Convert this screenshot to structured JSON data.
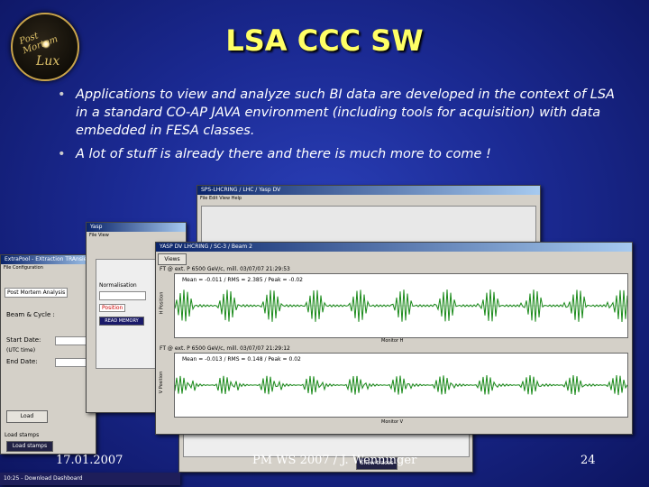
{
  "header": {
    "logo_text_top": "Post Mortem",
    "logo_text_bottom": "Lux",
    "title": "LSA CCC SW"
  },
  "bullets": [
    "Applications to view and analyze such BI data are developed in the context of LSA in a standard CO-AP JAVA environment (including tools for acquisition) with data embedded in FESA classes.",
    "A lot of stuff is already there and there is much more to come !"
  ],
  "screens": {
    "back_window_title": "SPS-LHCRING / LHC / Yasp DV",
    "left_window_title": "ExtraPool - EXtraction TRAnsient",
    "left_window": {
      "tab": "Post Mortem Analysis",
      "beam_cycle": "Beam & Cycle :",
      "start_date": "Start Date:",
      "utc_time": "(UTC time)",
      "end_date": "End Date:",
      "load_button": "Load",
      "tab2": "Load stamps",
      "status": "Load stamps"
    },
    "mid_window": {
      "label1": "Normalisation",
      "label2": "Position",
      "button": "READ MEMORY"
    },
    "front_window_title": "YASP DV LHCRING / SC-3 / Beam 2",
    "front_window": {
      "views_button": "Views",
      "plot1_header": "FT @ ext. P 6500 GeV/c, mill. 03/07/07 21:29:53",
      "plot1_stats": "Mean = -0.011 / RMS = 2.385 / Peak = -0.02",
      "plot1_ylabel": "H Position",
      "plot1_xlabel": "Monitor H",
      "plot2_header": "FT @ ext. P 6500 GeV/c, mill. 03/07/07 21:29:12",
      "plot2_stats": "Mean = -0.013 / RMS = 0.148 / Peak = 0.02",
      "plot2_ylabel": "V Position",
      "plot2_xlabel": "Monitor V"
    },
    "bottom_window": {
      "button": "Show traces"
    },
    "taskbar": "10:25 - Download Dashboard"
  },
  "footer": {
    "date": "17.01.2007",
    "event": "PM WS 2007 / J. Wenninger",
    "page": "24"
  },
  "colors": {
    "title": "#ffff66",
    "background": "#1b2a93",
    "plot_line": "#1a8a1a"
  }
}
